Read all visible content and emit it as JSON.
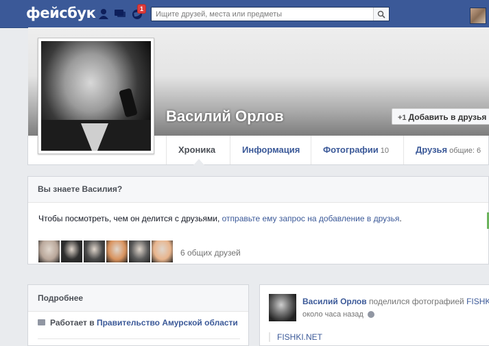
{
  "header": {
    "logo": "фейсбук",
    "notification_count": "1",
    "search_placeholder": "Ищите друзей, места или предметы"
  },
  "profile": {
    "name": "Василий Орлов",
    "add_friend_label": "Добавить в друзья"
  },
  "tabs": [
    {
      "label": "Хроника",
      "count": ""
    },
    {
      "label": "Информация",
      "count": ""
    },
    {
      "label": "Фотографии",
      "count": "10"
    },
    {
      "label": "Друзья",
      "count": "общие: 6"
    }
  ],
  "know_box": {
    "title": "Вы знаете Василия?",
    "text_before": "Чтобы посмотреть, чем он делится с друзьями, ",
    "link_text": "отправьте ему запрос на добавление в друзья",
    "text_after": ".",
    "mutual_label": "6 общих друзей",
    "mutual_faces": [
      {
        "name": "mutual-friend-1-avatar",
        "color": "#b9a79a"
      },
      {
        "name": "mutual-friend-2-avatar",
        "color": "#2f2f2f"
      },
      {
        "name": "mutual-friend-3-avatar",
        "color": "#4a4a4a"
      },
      {
        "name": "mutual-friend-4-avatar",
        "color": "#d8925d"
      },
      {
        "name": "mutual-friend-5-avatar",
        "color": "#5b5b5b"
      },
      {
        "name": "mutual-friend-6-avatar",
        "color": "#e8b48c"
      }
    ]
  },
  "about": {
    "title": "Подробнее",
    "work_prefix": "Работает в",
    "work_place": "Правительство Амурской области"
  },
  "post": {
    "author": "Василий Орлов",
    "action": "поделился фотографией",
    "source": "FISHKI",
    "time": "около часа назад",
    "link": "FISHKI.NET"
  }
}
